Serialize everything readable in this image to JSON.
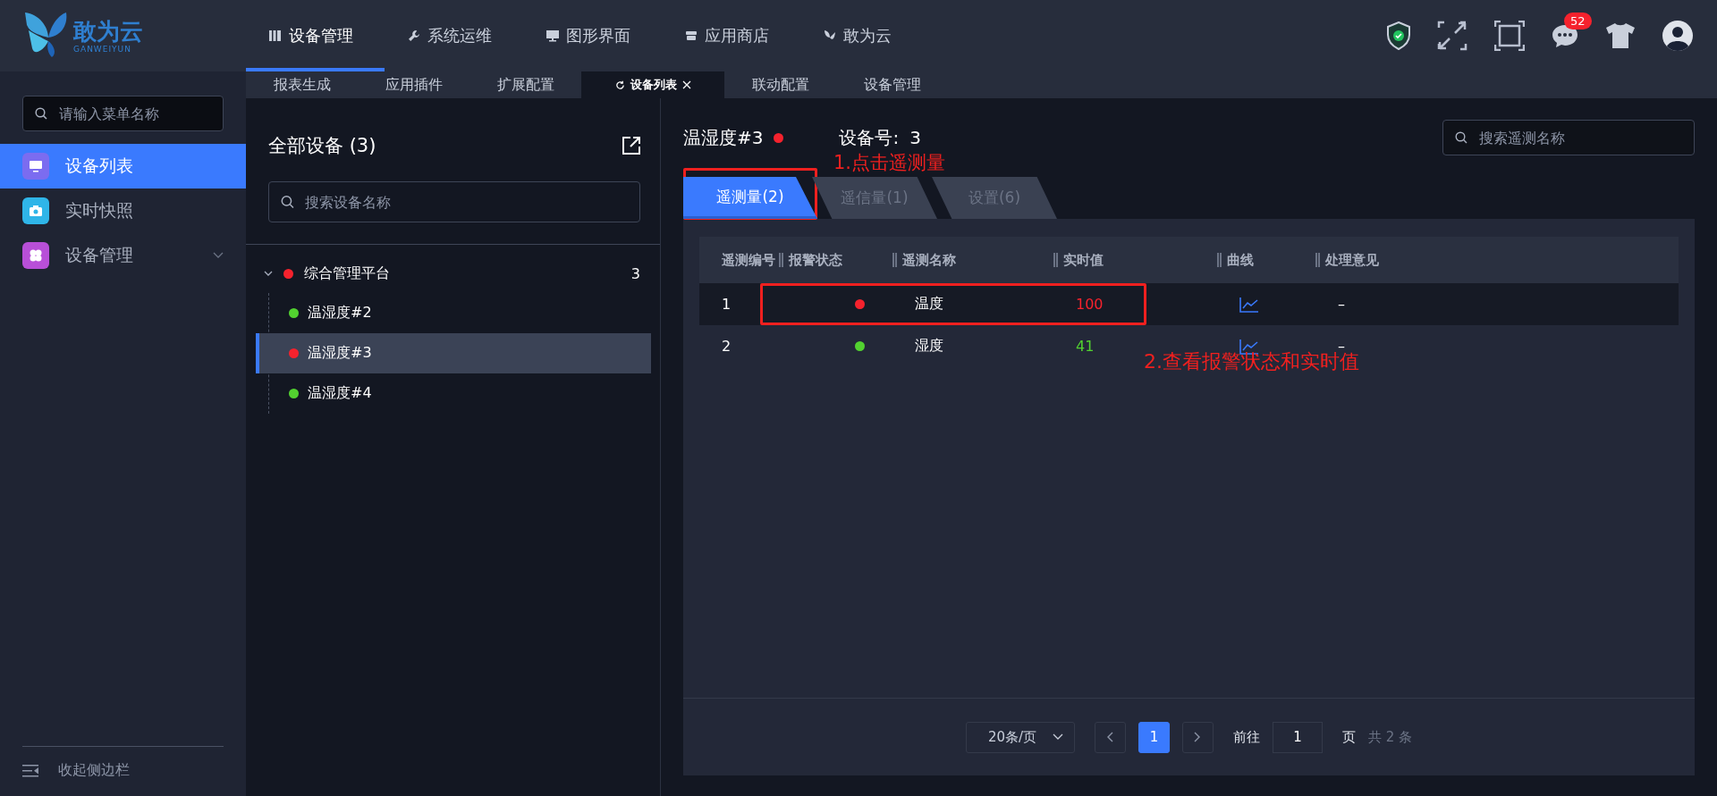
{
  "logo": {
    "name": "敢为云",
    "subtitle": "GANWEIYUN"
  },
  "nav": [
    {
      "label": "设备管理",
      "selected": true,
      "kind": "book"
    },
    {
      "label": "系统运维",
      "selected": false,
      "kind": "wrench"
    },
    {
      "label": "图形界面",
      "selected": false,
      "kind": "monitor"
    },
    {
      "label": "应用商店",
      "selected": false,
      "kind": "store"
    },
    {
      "label": "敢为云",
      "selected": false,
      "kind": "butterfly"
    }
  ],
  "notifications": {
    "count": "52"
  },
  "subtabs": [
    {
      "label": "报表生成",
      "selected": false
    },
    {
      "label": "应用插件",
      "selected": false
    },
    {
      "label": "扩展配置",
      "selected": false
    },
    {
      "label": "设备列表",
      "selected": true
    },
    {
      "label": "联动配置",
      "selected": false
    },
    {
      "label": "设备管理",
      "selected": false
    }
  ],
  "sidebar": {
    "search": {
      "placeholder": "请输入菜单名称"
    },
    "items": [
      {
        "label": "设备列表",
        "selected": true,
        "kind": "monitor",
        "color": "#7b6cf0",
        "expandable": false
      },
      {
        "label": "实时快照",
        "selected": false,
        "kind": "camera",
        "color": "#2fb5e8",
        "expandable": false
      },
      {
        "label": "设备管理",
        "selected": false,
        "kind": "clover",
        "color": "#b84fd8",
        "expandable": true
      }
    ],
    "collapse": "收起侧边栏"
  },
  "devices": {
    "title": "全部设备 (3)",
    "search": {
      "placeholder": "搜索设备名称"
    },
    "tree": [
      {
        "label": "综合管理平台",
        "color": "#f5222d",
        "count": "3",
        "expanded": true,
        "children": [
          {
            "label": "温湿度#2",
            "color": "#52d130",
            "selected": false
          },
          {
            "label": "温湿度#3",
            "color": "#f5222d",
            "selected": true
          },
          {
            "label": "温湿度#4",
            "color": "#52d130",
            "selected": false
          }
        ]
      }
    ]
  },
  "detail": {
    "device": "温湿度#3",
    "alarm": true,
    "number_label": "设备号:",
    "number": "3",
    "search": {
      "placeholder": "搜索遥测名称"
    },
    "tabs": [
      {
        "label": "遥测量(2)",
        "selected": true
      },
      {
        "label": "遥信量(1)",
        "selected": false
      },
      {
        "label": "设置(6)",
        "selected": false
      }
    ],
    "table": {
      "columns": [
        "遥测编号",
        "报警状态",
        "遥测名称",
        "实时值",
        "曲线",
        "处理意见"
      ],
      "rows": [
        {
          "no": "1",
          "alarm": true,
          "name": "温度",
          "value": "100",
          "remark": "–"
        },
        {
          "no": "2",
          "alarm": false,
          "name": "湿度",
          "value": "41",
          "remark": "–"
        }
      ]
    },
    "pagination": {
      "page_size": "20条/页",
      "pages": [
        {
          "label": "1",
          "selected": true
        }
      ],
      "goto_label": "前往",
      "goto_value": "1",
      "page_unit": "页",
      "total": "共 2 条"
    }
  },
  "annotations": [
    "1.点击遥测量",
    "2.查看报警状态和实时值"
  ]
}
